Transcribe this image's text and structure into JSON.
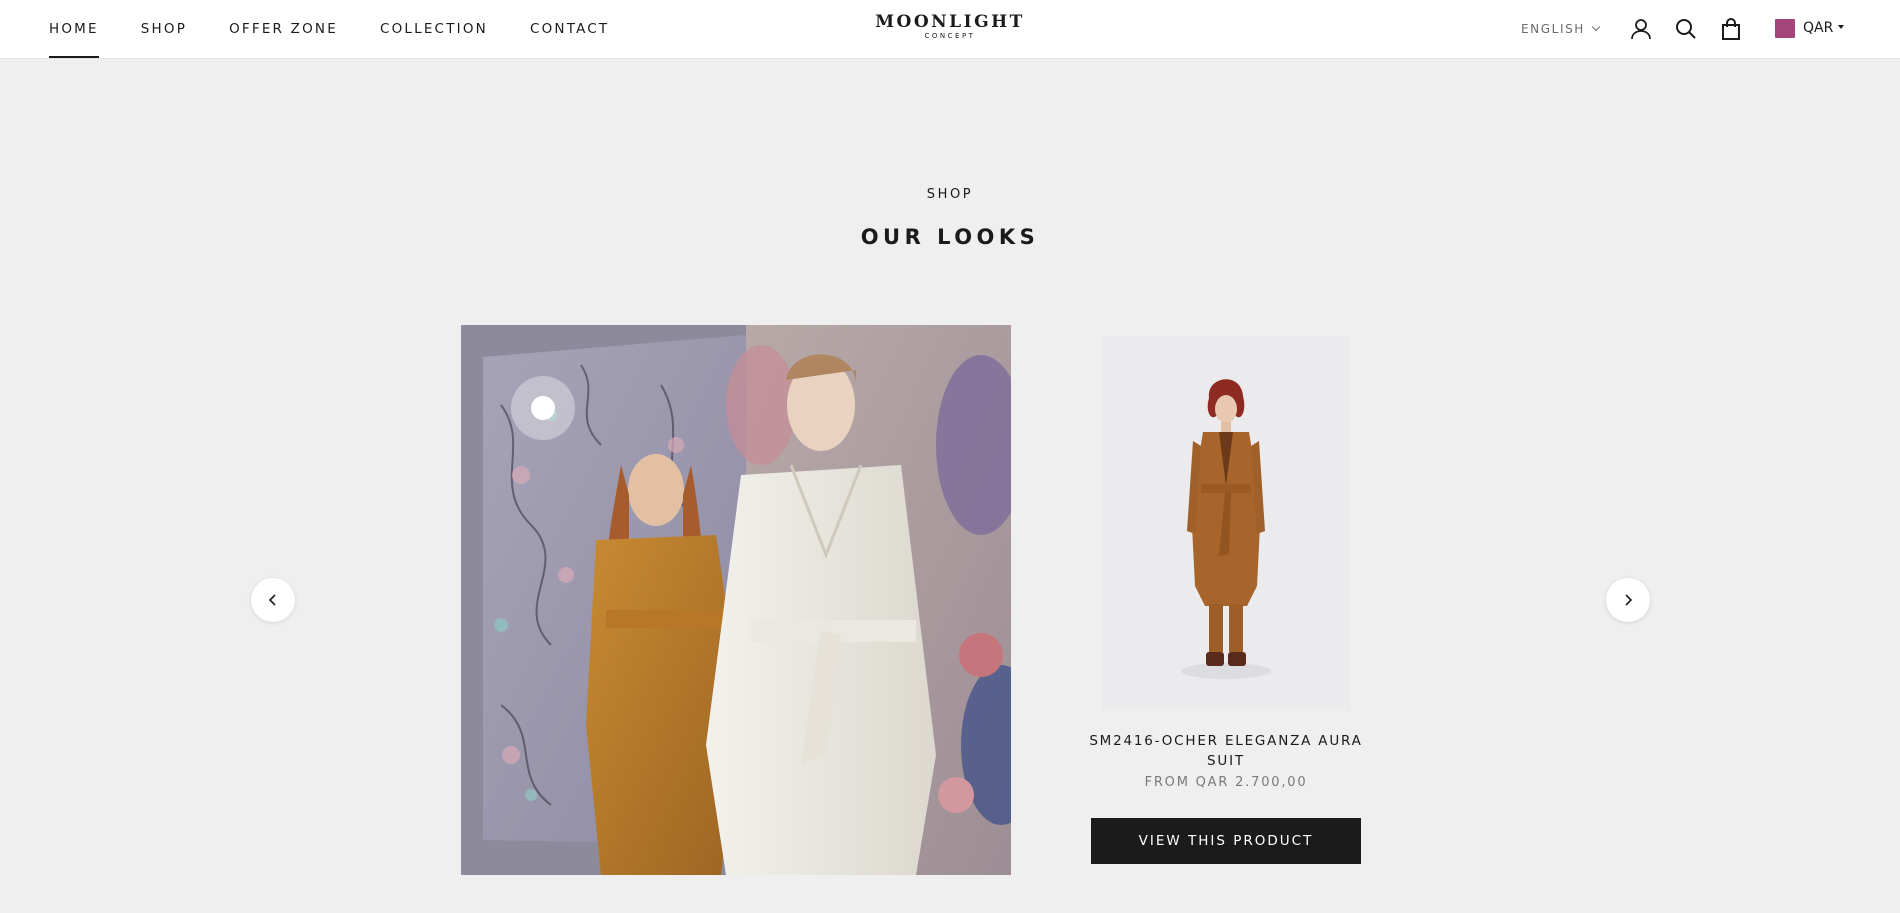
{
  "header": {
    "nav": [
      {
        "label": "HOME",
        "active": true
      },
      {
        "label": "SHOP"
      },
      {
        "label": "OFFER ZONE"
      },
      {
        "label": "COLLECTION"
      },
      {
        "label": "CONTACT"
      }
    ],
    "logo_main": "MOONLIGHT",
    "logo_sub": "CONCEPT",
    "language": "ENGLISH",
    "currency": "QAR",
    "icons": [
      "account-icon",
      "search-icon",
      "cart-icon"
    ],
    "flag_color": "#a3457a"
  },
  "section": {
    "eyebrow": "SHOP",
    "title": "OUR LOOKS"
  },
  "carousel": {
    "prev_icon": "chevron-left-icon",
    "next_icon": "chevron-right-icon"
  },
  "product": {
    "name": "SM2416-OCHER ELEGANZA AURA SUIT",
    "price": "FROM QAR 2.700,00",
    "button": "VIEW THIS PRODUCT"
  },
  "colors": {
    "background": "#efefef",
    "text": "#1c1b1b",
    "button": "#1c1b1b",
    "ocher": "#b5782a"
  }
}
